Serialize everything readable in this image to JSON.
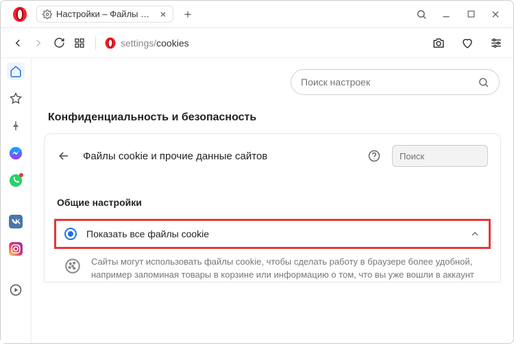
{
  "window": {
    "tab_title": "Настройки – Файлы cookie"
  },
  "address": {
    "prefix": "settings/",
    "path": "cookies"
  },
  "search": {
    "placeholder": "Поиск настроек"
  },
  "section_heading": "Конфиденциальность и безопасность",
  "panel": {
    "title": "Файлы cookie и прочие данные сайтов",
    "search_placeholder": "Поиск"
  },
  "general": {
    "heading": "Общие настройки",
    "option_label": "Показать все файлы cookie",
    "description": "Сайты могут использовать файлы cookie, чтобы сделать работу в браузере более удобной, например запоминая товары в корзине или информацию о том, что вы уже вошли в аккаунт"
  }
}
